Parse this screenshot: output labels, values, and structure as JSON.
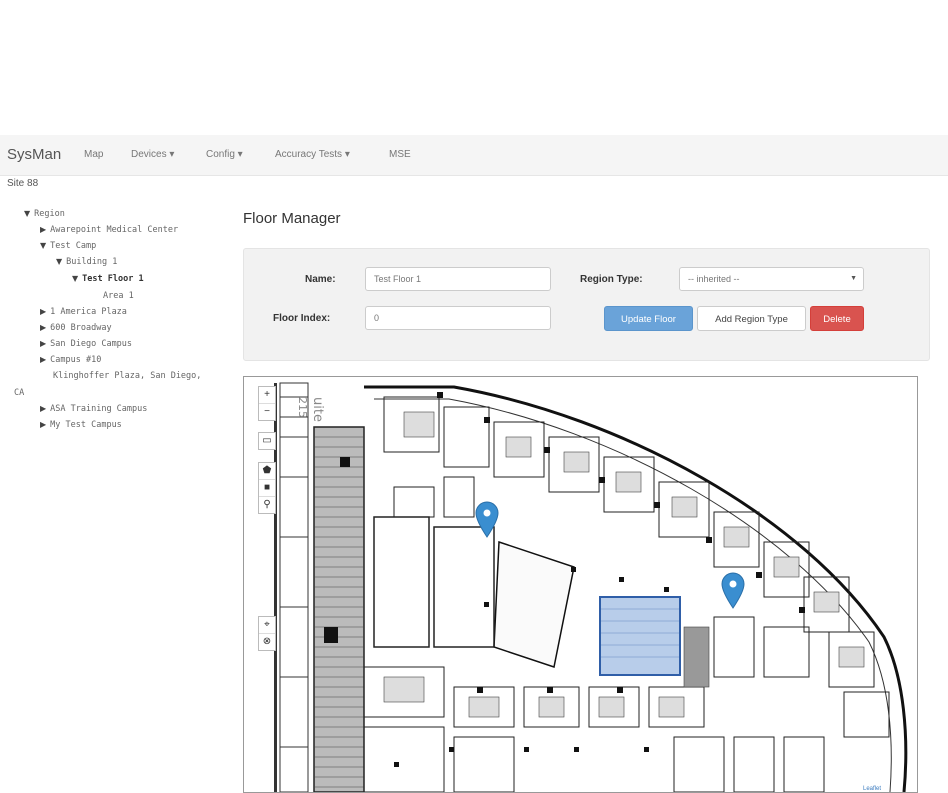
{
  "navbar": {
    "brand": "SysMan",
    "items": [
      "Map",
      "Devices ▾",
      "Config ▾",
      "Accuracy Tests ▾",
      "MSE"
    ]
  },
  "site_label": "Site 88",
  "tree": [
    {
      "label": "Region",
      "expanded": true
    },
    {
      "label": "Awarepoint Medical Center"
    },
    {
      "label": "Test Camp",
      "expanded": true
    },
    {
      "label": "Building 1",
      "expanded": true
    },
    {
      "label": "Test Floor 1",
      "expanded": true
    },
    {
      "label": "Area 1"
    },
    {
      "label": "1 America Plaza"
    },
    {
      "label": "600 Broadway"
    },
    {
      "label": "San Diego Campus"
    },
    {
      "label": "Campus #10"
    },
    {
      "label": "Klinghoffer Plaza, San Diego,"
    },
    {
      "label": "CA"
    },
    {
      "label": "ASA Training Campus"
    },
    {
      "label": "My Test Campus"
    }
  ],
  "page_title": "Floor Manager",
  "form": {
    "name_label": "Name:",
    "name_value": "Test Floor 1",
    "region_type_label": "Region Type:",
    "region_type_value": "-- inherited --",
    "floor_index_label": "Floor Index:",
    "floor_index_value": "0",
    "update_button": "Update Floor",
    "add_region_button": "Add Region Type",
    "delete_button": "Delete"
  },
  "map": {
    "controls": [
      "+",
      "−",
      "▭",
      "⬟",
      "■",
      "⚲",
      "⌖",
      "⊗"
    ],
    "plan_label_1": "uite",
    "plan_label_2": "215",
    "attribution": "Leaflet",
    "marker_color": "#3a8ed0",
    "highlight_color": "#7ea4d8"
  }
}
